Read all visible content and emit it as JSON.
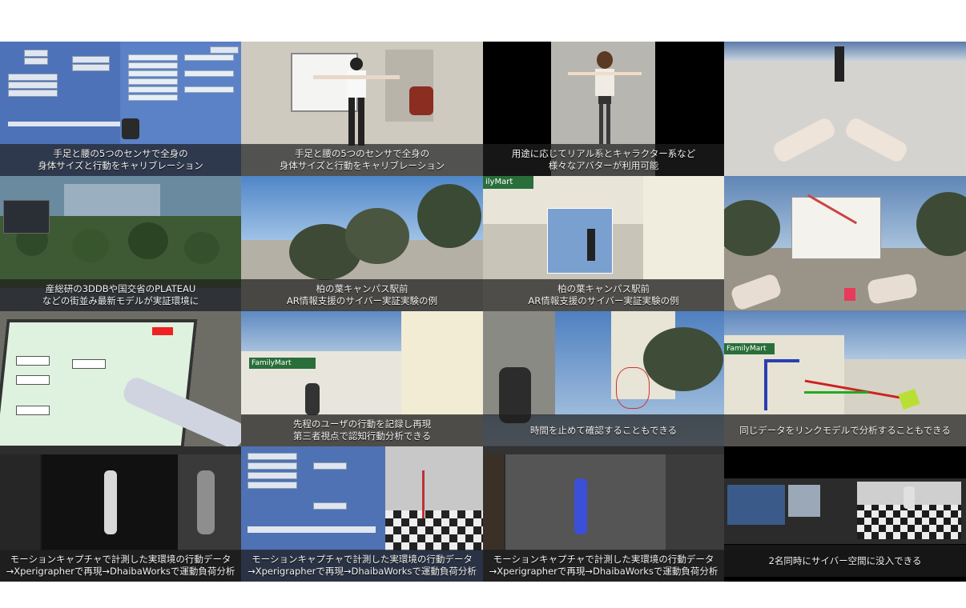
{
  "tiles": [
    {
      "lines": [
        "手足と腰の5つのセンサで全身の",
        "身体サイズと行動をキャリブレーション"
      ]
    },
    {
      "lines": [
        "手足と腰の5つのセンサで全身の",
        "身体サイズと行動をキャリブレーション"
      ]
    },
    {
      "lines": [
        "用途に応じてリアル系とキャラクター系など",
        "様々なアバターが利用可能"
      ]
    },
    {
      "lines": []
    },
    {
      "lines": [
        "産総研の3DDBや国交省のPLATEAU",
        "などの街並み最新モデルが実証環境に"
      ]
    },
    {
      "lines": [
        "柏の葉キャンパス駅前",
        "AR情報支援のサイバー実証実験の例"
      ]
    },
    {
      "lines": [
        "柏の葉キャンパス駅前",
        "AR情報支援のサイバー実証実験の例"
      ]
    },
    {
      "lines": []
    },
    {
      "lines": []
    },
    {
      "lines": [
        "先程のユーザの行動を記録し再現",
        "第三者視点で認知行動分析できる"
      ]
    },
    {
      "lines": [
        "時間を止めて確認することもできる"
      ]
    },
    {
      "lines": [
        "同じデータをリンクモデルで分析することもできる"
      ]
    },
    {
      "lines": [
        "モーションキャプチャで計測した実環境の行動データ",
        "→Xperigrapherで再現→DhaibaWorksで運動負荷分析"
      ]
    },
    {
      "lines": [
        "モーションキャプチャで計測した実環境の行動データ",
        "→Xperigrapherで再現→DhaibaWorksで運動負荷分析"
      ]
    },
    {
      "lines": [
        "モーションキャプチャで計測した実環境の行動データ",
        "→Xperigrapherで再現→DhaibaWorksで運動負荷分析"
      ]
    },
    {
      "lines": [
        "2名同時にサイバー空間に没入できる"
      ]
    }
  ],
  "signs": {
    "store": "FamilyMart",
    "store_short": "FamilyMart",
    "store_partial": "ilyMart"
  },
  "colors": {
    "caption_bg": "#1e1e1e",
    "sky": "#7fa9d8",
    "ui_panel": "#4a6da8"
  }
}
